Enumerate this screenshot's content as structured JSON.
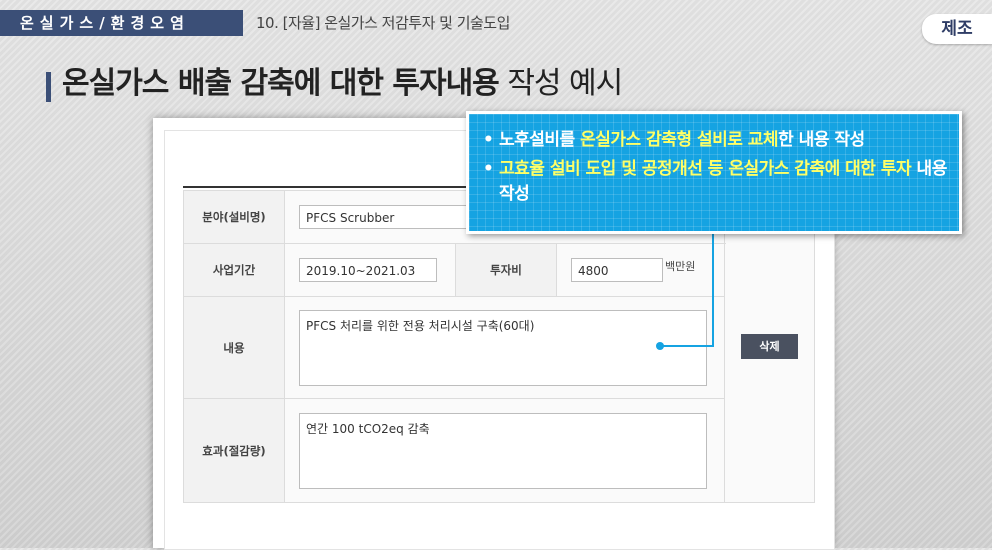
{
  "header": {
    "category": "온실가스/환경오염",
    "lesson": "10. [자율] 온실가스 저감투자 및 기술도입",
    "tag": "제조"
  },
  "title": {
    "bold": "온실가스 배출 감축에 대한 투자내용",
    "normal": " 작성 예시"
  },
  "form": {
    "field_label": "분야(설비명)",
    "field_value": "PFCS Scrubber",
    "period_label": "사업기간",
    "period_value": "2019.10~2021.03",
    "cost_label": "투자비",
    "cost_value": "4800",
    "cost_unit": "백만원",
    "content_label": "내용",
    "content_value": "PFCS 처리를 위한 전용 처리시설 구축(60대)",
    "effect_label": "효과(절감량)",
    "effect_value": "연간 100 tCO2eq 감축",
    "delete_label": "삭제"
  },
  "callout": {
    "item1": {
      "part1": "노후설비를 ",
      "part2": "온실가스 감축형 설비로 교체",
      "part3": "한 내용 작성"
    },
    "item2": {
      "part1": "고효율 설비 도입 및 공정개선 등 온실가스 감축에 대한 투자",
      "part2": " 내용 작성"
    }
  },
  "colors": {
    "header_bar": "#3b4f77",
    "callout_bg": "#15a3e2",
    "highlight": "#ffff66",
    "delete_button": "#4a5160"
  }
}
